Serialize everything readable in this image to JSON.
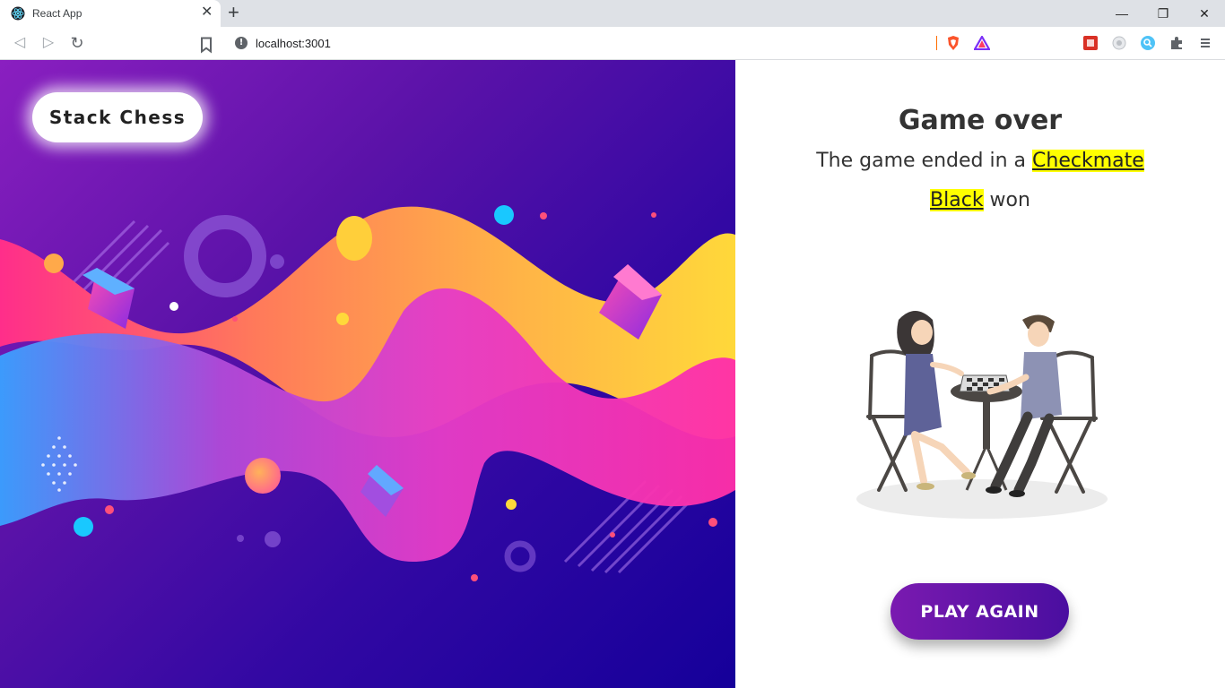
{
  "browser": {
    "tab_title": "React App",
    "tab_close": "✕",
    "new_tab": "+",
    "url": "localhost:3001",
    "info_glyph": "!",
    "window": {
      "minimize": "—",
      "restore": "❐",
      "close": "✕"
    },
    "nav": {
      "back": "◁",
      "forward": "▷",
      "reload": "↻",
      "bookmark": "🔖"
    },
    "extensions": [
      "brave-shield-icon",
      "brave-rewards-icon",
      "extension-red-icon",
      "extension-gray-icon",
      "extension-blue-icon",
      "puzzle-icon",
      "menu-icon"
    ]
  },
  "hero": {
    "brand": "Stack Chess"
  },
  "result": {
    "title": "Game over",
    "line1_prefix": "The game ended in a ",
    "reason": "Checkmate",
    "winner": "Black",
    "line2_suffix": " won"
  },
  "actions": {
    "play_again": "PLAY AGAIN"
  },
  "colors": {
    "highlight": "#ffff00",
    "button_start": "#7a1ab0",
    "button_end": "#4a0ea0"
  }
}
